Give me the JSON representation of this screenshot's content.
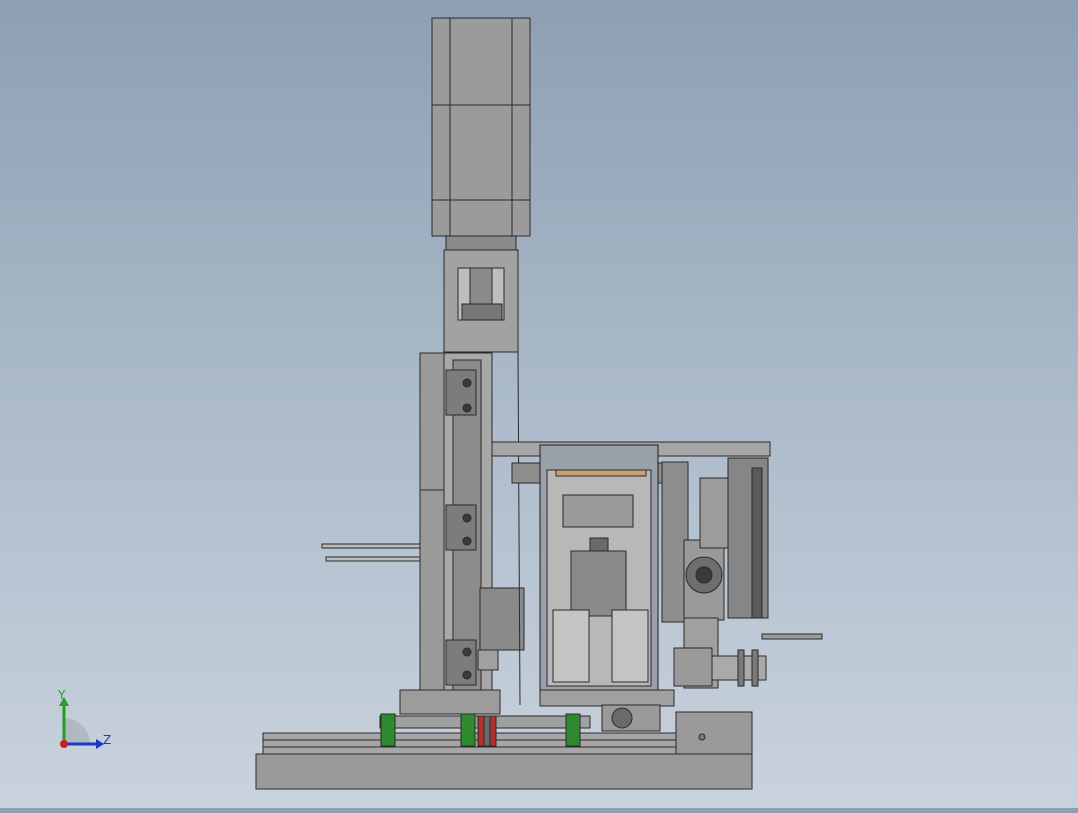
{
  "viewport": {
    "triad": {
      "y_label": "Y",
      "z_label": "Z",
      "colors": {
        "y_axis": "#22a022",
        "z_axis": "#2036c8",
        "x_axis": "#cc1f1f",
        "quadrant": "#b0b8c2"
      }
    },
    "model_colors": {
      "body_gray": "#8c8c8c",
      "light_gray": "#a8a8a8",
      "dark_gray": "#5c5c5c",
      "line": "#2a2a2a",
      "rail_green": "#2f8a2f",
      "accent_red": "#b03030",
      "accent_tan": "#c8a26a"
    }
  }
}
